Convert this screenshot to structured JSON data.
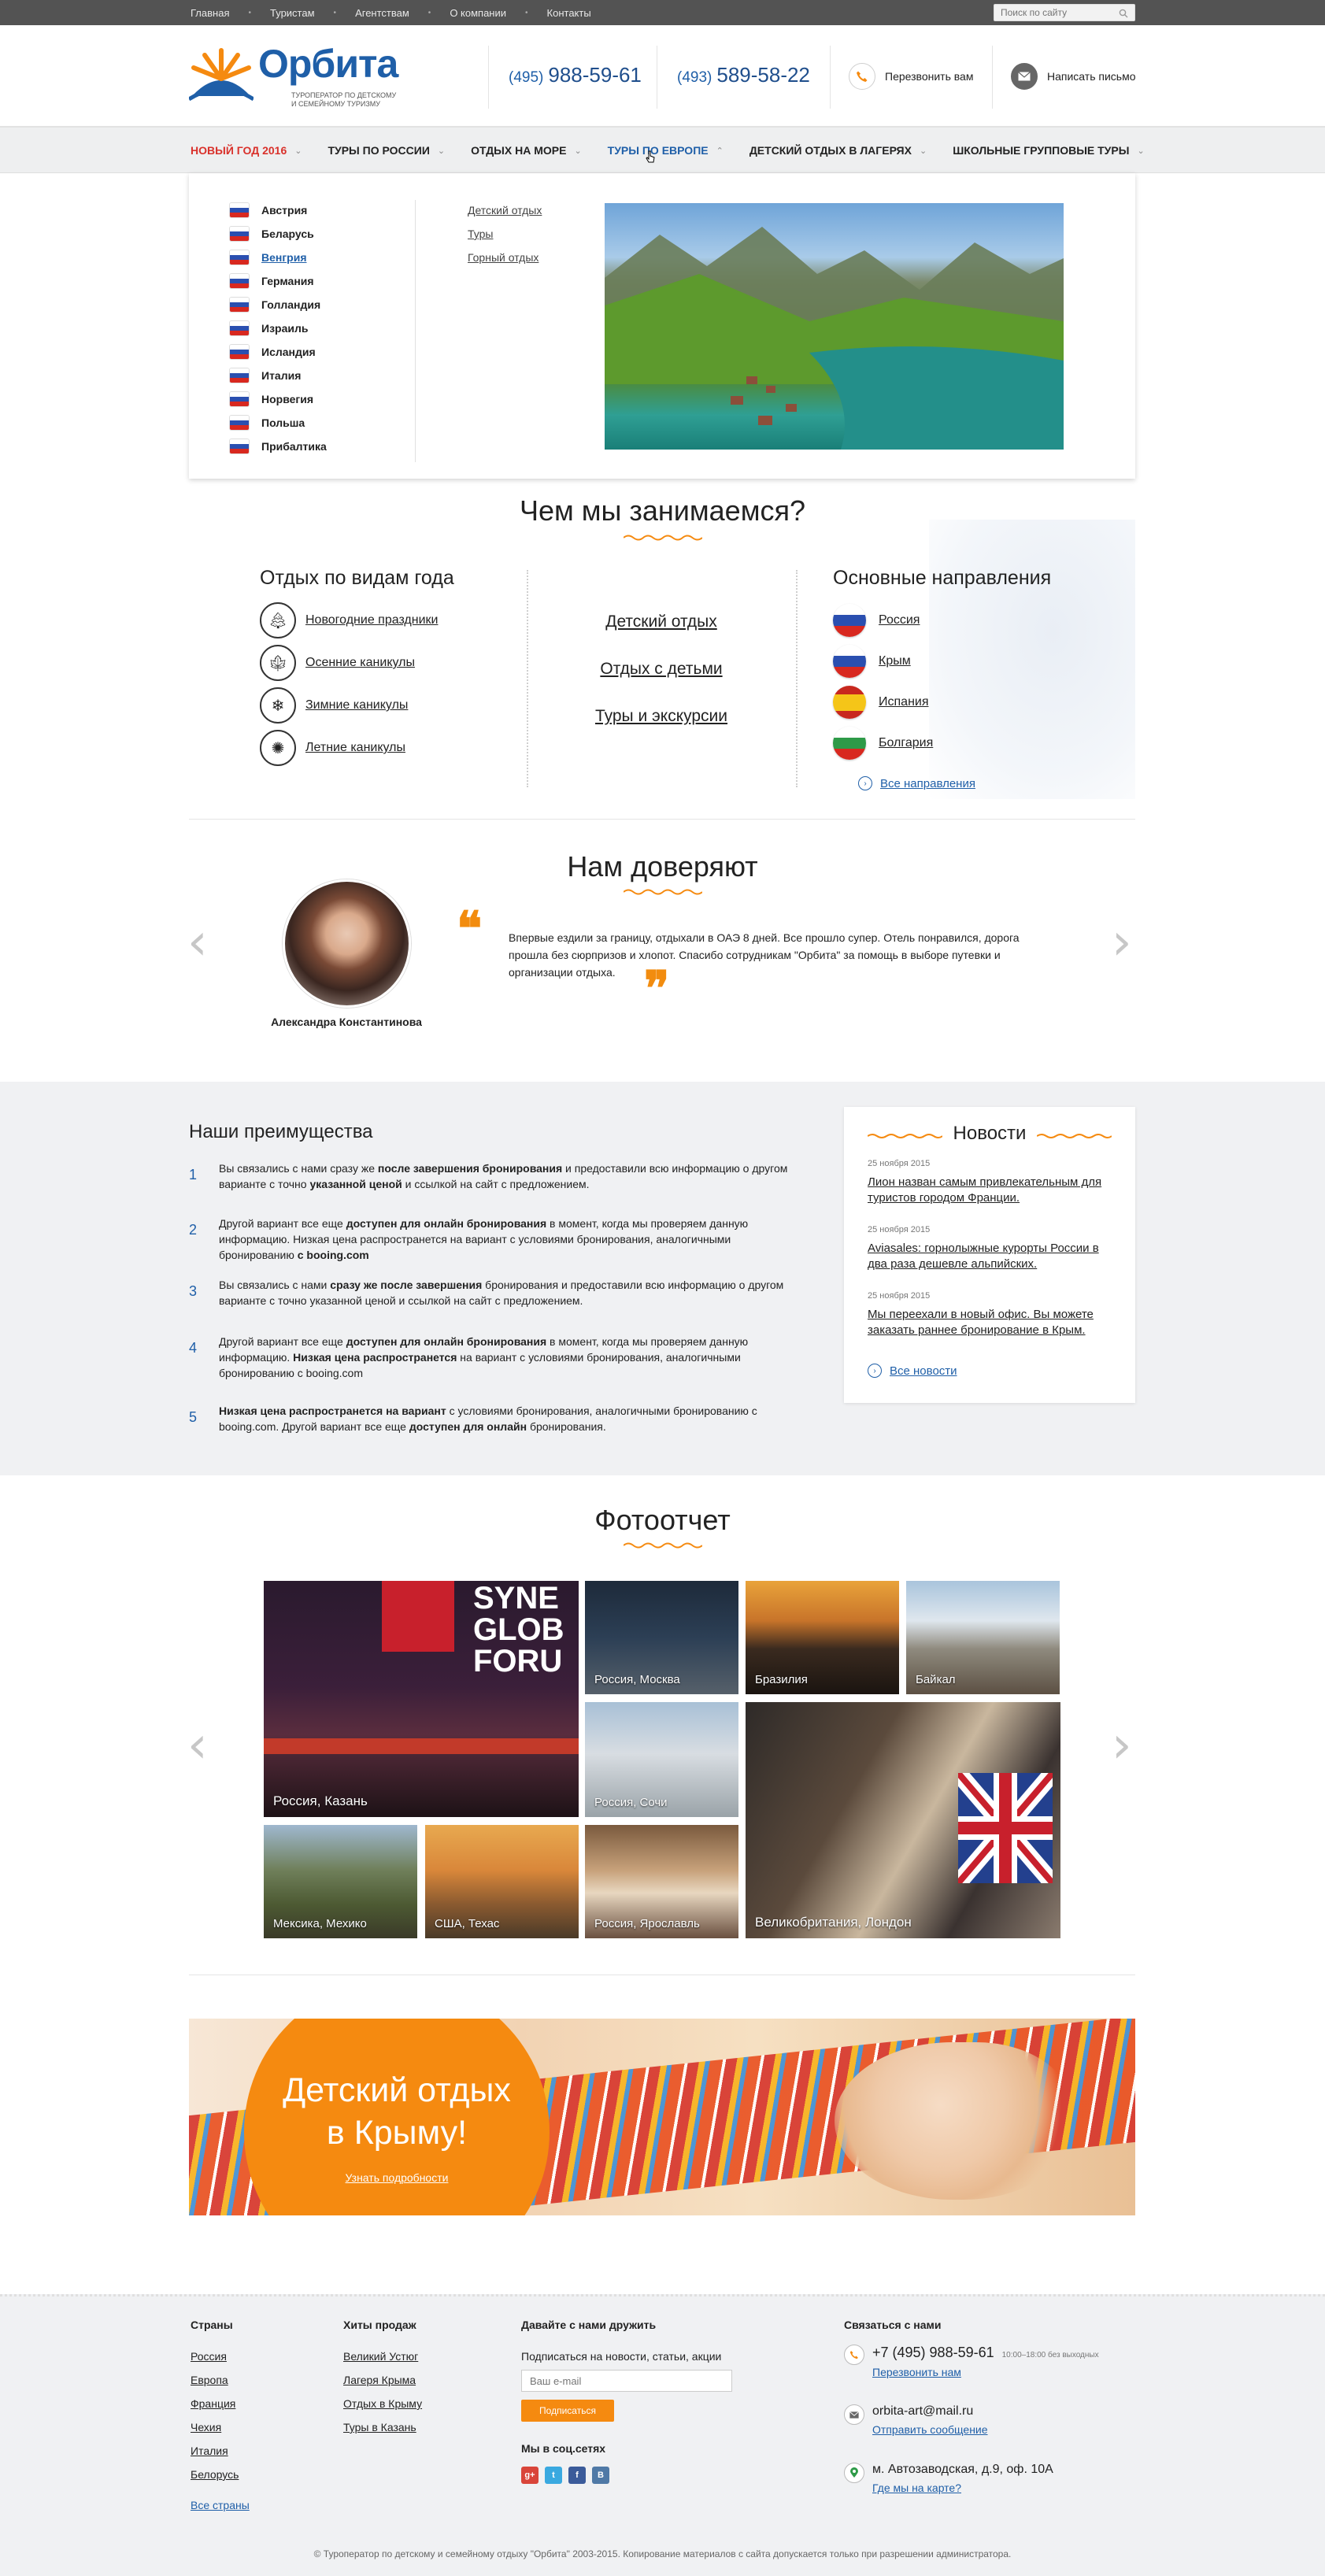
{
  "topbar": {
    "links": [
      "Главная",
      "Туристам",
      "Агентствам",
      "О компании",
      "Контакты"
    ],
    "search_placeholder": "Поиск по сайту"
  },
  "header": {
    "logo_name": "Орбита",
    "logo_tagline": "ТУРОПЕРАТОР ПО ДЕТСКОМУ И СЕМЕЙНОМУ ТУРИЗМУ",
    "phone1_code": "(495)",
    "phone1_number": "988-59-61",
    "phone2_code": "(493)",
    "phone2_number": "589-58-22",
    "callback_label": "Перезвонить вам",
    "write_label": "Написать письмо"
  },
  "nav": {
    "items": [
      "НОВЫЙ ГОД 2016",
      "ТУРЫ ПО РОССИИ",
      "ОТДЫХ НА МОРЕ",
      "ТУРЫ ПО ЕВРОПЕ",
      "ДЕТСКИЙ ОТДЫХ В ЛАГЕРЯХ",
      "ШКОЛЬНЫЕ ГРУППОВЫЕ ТУРЫ"
    ]
  },
  "dropdown": {
    "countries": [
      "Австрия",
      "Беларусь",
      "Венгрия",
      "Германия",
      "Голландия",
      "Израиль",
      "Исландия",
      "Италия",
      "Норвегия",
      "Польша",
      "Прибалтика"
    ],
    "sublinks": [
      "Детский отдых",
      "Туры",
      "Горный отдых"
    ]
  },
  "what_we_do": {
    "title": "Чем мы занимаемся?",
    "left_title": "Отдых по видам года",
    "seasons": [
      "Новогодние праздники",
      "Осенние каникулы",
      "Зимние каникулы",
      "Летние каникулы"
    ],
    "middle_links": [
      "Детский отдых",
      "Отдых с детьми",
      "Туры и экскурсии"
    ],
    "right_title": "Основные направления",
    "directions": [
      "Россия",
      "Крым",
      "Испания",
      "Болгария"
    ],
    "all_directions": "Все направления"
  },
  "testimonials": {
    "title": "Нам доверяют",
    "name": "Александра Константинова",
    "text": "Впервые ездили за границу, отдыхали в ОАЭ 8 дней. Все прошло супер. Отель понравился, дорога прошла без сюрпризов и хлопот. Спасибо сотрудникам \"Орбита\" за помощь в выборе путевки и организации отдыха."
  },
  "advantages": {
    "title": "Наши преимущества",
    "items": [
      {
        "n": "1",
        "html": "Вы связались с нами сразу же <b>после завершения бронирования</b> и предоставили всю информацию о другом варианте с точно <b>указанной ценой</b> и ссылкой на сайт с предложением."
      },
      {
        "n": "2",
        "html": "Другой вариант все еще <b>доступен для онлайн бронирования</b> в момент, когда мы проверяем данную информацию. Низкая цена распространется на вариант с условиями бронирования, аналогичными бронированию <b>с booing.com</b>"
      },
      {
        "n": "3",
        "html": "Вы связались с нами <b>сразу же после завершения</b> бронирования и предоставили всю информацию о другом варианте с точно указанной ценой и ссылкой на сайт с предложением."
      },
      {
        "n": "4",
        "html": "Другой вариант все еще <b>доступен для онлайн бронирования</b> в момент, когда мы проверяем данную информацию. <b>Низкая цена распространется</b> на вариант с условиями бронирования, аналогичными бронированию с booing.com"
      },
      {
        "n": "5",
        "html": "<b>Низкая цена распространется на вариант</b> с условиями бронирования, аналогичными бронированию с booing.com. Другой вариант все еще <b>доступен для онлайн</b> бронирования."
      }
    ]
  },
  "news": {
    "title": "Новости",
    "items": [
      {
        "date": "25 ноября 2015",
        "text": "Лион назван самым привлекательным для туристов городом Франции."
      },
      {
        "date": "25 ноября 2015",
        "text": "Aviasales: горнолыжные курорты России в два раза дешевле альпийских."
      },
      {
        "date": "25 ноября 2015",
        "text": "Мы переехали в новый офис. Вы можете заказать раннее бронирование в Крым."
      }
    ],
    "all_news": "Все новости"
  },
  "photos": {
    "title": "Фотоотчет",
    "labels": [
      "Россия, Казань",
      "Россия, Москва",
      "Бразилия",
      "Байкал",
      "Россия, Сочи",
      "Великобритания, Лондон",
      "Мексика, Мехико",
      "США, Техас",
      "Россия, Ярославль"
    ],
    "kazan_banner": "SYNE GLOB FORU"
  },
  "banner": {
    "title_line1": "Детский отдых",
    "title_line2": "в Крыму!",
    "link": "Узнать подробности"
  },
  "footer": {
    "countries_title": "Страны",
    "countries": [
      "Россия",
      "Европа",
      "Франция",
      "Чехия",
      "Италия",
      "Белорусь"
    ],
    "all_countries": "Все страны",
    "hits_title": "Хиты продаж",
    "hits": [
      "Великий Устюг",
      "Лагеря Крыма",
      "Отдых в Крыму",
      "Туры в Казань"
    ],
    "friends_title": "Давайте с нами дружить",
    "subscribe_text": "Подписаться на новости, статьи, акции",
    "email_placeholder": "Ваш e-mail",
    "subscribe_button": "Подписаться",
    "social_title": "Мы в соц.сетях",
    "social": [
      "g+",
      "t",
      "f",
      "В"
    ],
    "contact_title": "Связаться с нами",
    "phone": "+7 (495) 988-59-61",
    "hours": "10:00–18:00 без выходных",
    "callback": "Перезвонить нам",
    "email": "orbita-art@mail.ru",
    "send_message": "Отправить сообщение",
    "address": "м. Автозаводская, д.9, оф. 10А",
    "map_link": "Где мы на карте?",
    "copyright": "© Туроператор по детскому и семейному отдыху \"Орбита\" 2003-2015. Копирование материалов с сайта допускается только при разрешении администратора."
  },
  "colors": {
    "brand_blue": "#1f5fa8",
    "accent_orange": "#f58a10",
    "nav_red": "#d9312b"
  }
}
